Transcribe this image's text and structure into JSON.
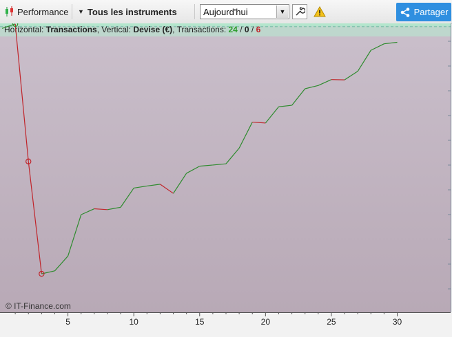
{
  "toolbar": {
    "performance_label": "Performance",
    "instruments_label": "Tous les instruments",
    "period_value": "Aujourd'hui",
    "share_label": "Partager"
  },
  "chart_header": {
    "h_prefix": "Horizontal: ",
    "h_value": "Transactions",
    "v_prefix": ", Vertical: ",
    "v_value": "Devise (€)",
    "t_prefix": ", Transactions: ",
    "win": "24",
    "slash1": " / ",
    "neutral": "0",
    "slash2": " / ",
    "loss": "6"
  },
  "watermark": "© IT-Finance.com",
  "colors": {
    "gain": "#2e8b2e",
    "loss": "#c0242a",
    "positive_zone": "#aee3c8",
    "negative_zone": "#c9bcc8",
    "accent": "#2f8fe0"
  },
  "chart_data": {
    "type": "line",
    "xlabel": "Transactions",
    "ylabel": "Devise (€)",
    "x_ticks": [
      "5",
      "10",
      "15",
      "20",
      "25",
      "30"
    ],
    "xlim": [
      0,
      34
    ],
    "zero_line": 1.8,
    "ylim": [
      -95,
      2.7
    ],
    "x": [
      0,
      1,
      2,
      3,
      4,
      5,
      6,
      7,
      8,
      9,
      10,
      11,
      12,
      13,
      14,
      15,
      16,
      17,
      18,
      19,
      20,
      21,
      22,
      23,
      24,
      25,
      26,
      27,
      28,
      29,
      30
    ],
    "y": [
      1,
      2.5,
      -44,
      -82,
      -81,
      -76,
      -62,
      -60,
      -60.3,
      -59.5,
      -53,
      -52.3,
      -51.7,
      -54.8,
      -48,
      -45.6,
      -45.2,
      -44.8,
      -39.5,
      -30.7,
      -31,
      -25.5,
      -25,
      -19.4,
      -18.3,
      -16.3,
      -16.4,
      -13.5,
      -6.4,
      -4.2,
      -3.7
    ]
  }
}
